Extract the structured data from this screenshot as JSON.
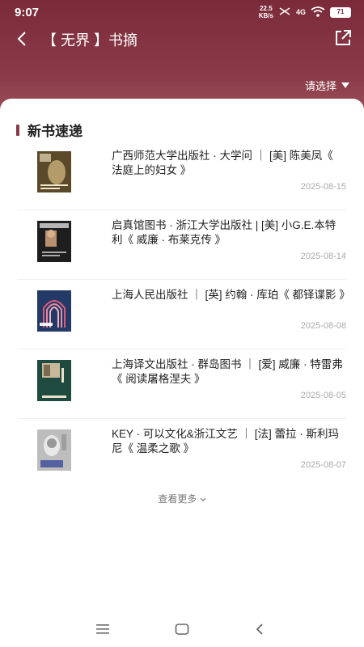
{
  "status": {
    "time": "9:07",
    "net_speed": "22.5",
    "net_unit": "KB/s",
    "signal": "4G",
    "battery": "71"
  },
  "nav": {
    "title": "【 无界 】书摘"
  },
  "filter": {
    "label": "请选择"
  },
  "section": {
    "title": "新书速递"
  },
  "books": [
    {
      "title": "广西师范大学出版社 · 大学问 ｜ [美] 陈美凤《 法庭上的妇女 》",
      "date": "2025-08-15",
      "cover_color": "#5a4a2a"
    },
    {
      "title": "启真馆图书 · 浙江大学出版社 | [美] 小G.E.本特利《 威廉 · 布莱克传 》",
      "date": "2025-08-14",
      "cover_color": "#1e1e1e"
    },
    {
      "title": "上海人民出版社 ｜ [英] 约翰 · 库珀《 都铎谍影 》",
      "date": "2025-08-08",
      "cover_color": "#233a66"
    },
    {
      "title": "上海译文出版社 · 群岛图书 ｜ [爱] 威廉 · 特雷弗《 阅读屠格涅夫 》",
      "date": "2025-08-05",
      "cover_color": "#1f4a40"
    },
    {
      "title": "KEY · 可以文化&浙江文艺 ｜ [法] 蕾拉 · 斯利玛尼《 温柔之歌 》",
      "date": "2025-08-07",
      "cover_color": "#bdbdbd"
    }
  ],
  "more": {
    "label": "查看更多"
  }
}
